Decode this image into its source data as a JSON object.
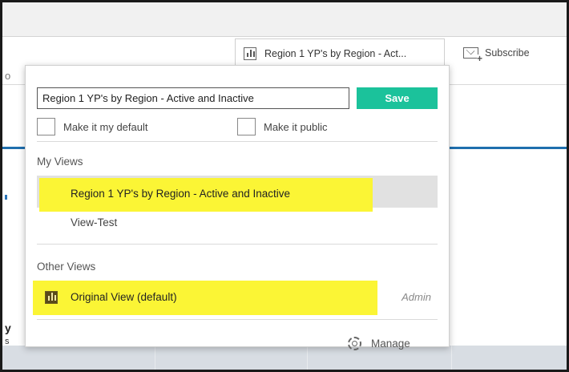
{
  "toolbar": {
    "views_button_label": "Region 1 YP's by Region - Act...",
    "subscribe_label": "Subscribe"
  },
  "peek": {
    "left_o": "o",
    "left_y": "y",
    "left_s": "s"
  },
  "panel": {
    "name_value": "Region 1 YP's by Region - Active and Inactive",
    "save_label": "Save",
    "make_default_label": "Make it my default",
    "make_public_label": "Make it public",
    "my_views_heading": "My Views",
    "my_views": [
      {
        "label": "Region 1 YP's by Region - Active and Inactive"
      },
      {
        "label": "View-Test"
      }
    ],
    "other_views_heading": "Other Views",
    "other_views": [
      {
        "label": "Original View (default)",
        "owner": "Admin"
      }
    ],
    "manage_label": "Manage"
  },
  "colors": {
    "save_button": "#1bc29b",
    "highlight": "#fbf535",
    "selected_row": "#e1e1e1",
    "accent_line": "#1f6fae"
  },
  "icons": {
    "views_button": "bar-chart-icon",
    "subscribe": "mail-plus-icon",
    "original_view": "bar-chart-icon",
    "manage": "gear-icon"
  }
}
